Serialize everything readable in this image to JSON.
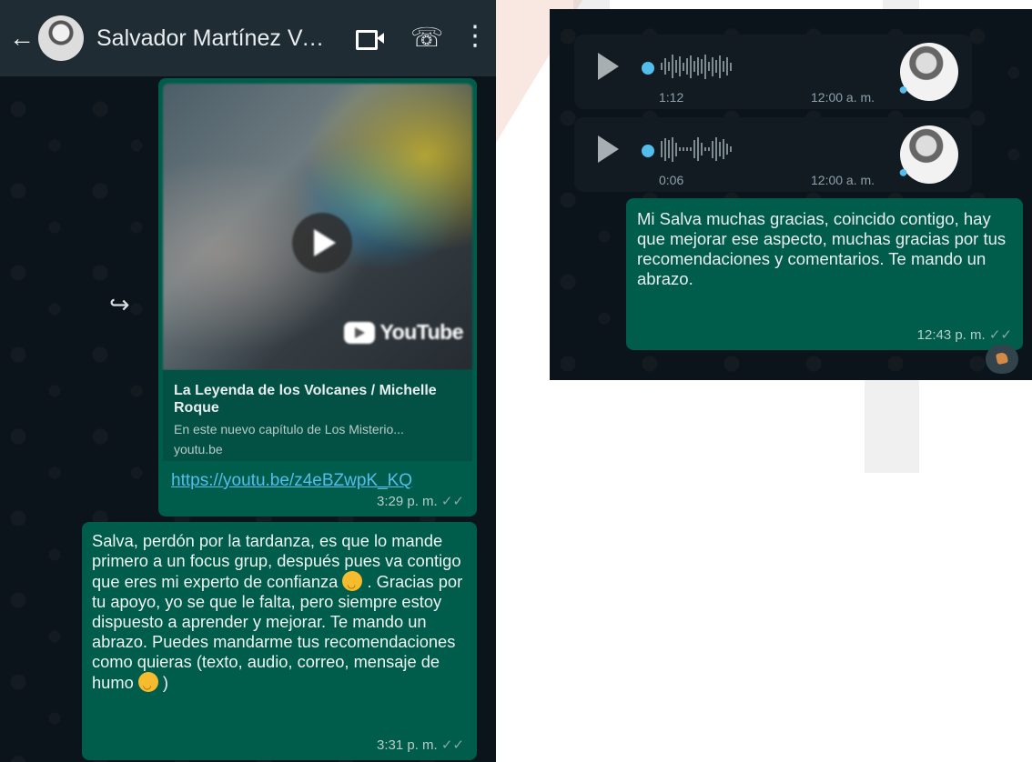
{
  "header": {
    "contact_name": "Salvador Martínez Ve...",
    "back_icon": "arrow-left",
    "video_call_icon": "video-camera",
    "voice_call_icon": "phone",
    "menu_icon": "vertical-ellipsis"
  },
  "conversation_left": {
    "forward_icon": "forward-arrow",
    "video_message": {
      "youtube_label": "YouTube",
      "title": "La Leyenda de los Volcanes / Michelle Roque",
      "description": "En este nuevo capítulo de Los Misterio...",
      "domain": "youtu.be",
      "url": "https://youtu.be/z4eBZwpK_KQ",
      "time": "3:29 p. m.",
      "ticks": "✓✓"
    },
    "text_message": {
      "part1": "Salva, perdón por la tardanza, es que lo mande primero a un focus grup, después pues va contigo que eres mi experto de confianza",
      "part2": ". Gracias por tu apoyo, yo se que le falta, pero siempre estoy dispuesto a aprender y mejorar. Te mando un abrazo. Puedes mandarme tus recomendaciones como quieras (texto, audio, correo, mensaje de humo",
      "part3": ")",
      "time": "3:31 p. m.",
      "ticks": "✓✓"
    }
  },
  "conversation_right": {
    "voice_notes": [
      {
        "duration": "1:12",
        "time": "12:00 a. m."
      },
      {
        "duration": "0:06",
        "time": "12:00 a. m."
      }
    ],
    "reply": {
      "text": "Mi Salva muchas gracias, coincido contigo, hay que mejorar ese aspecto, muchas gracias por tus recomendaciones y comentarios. Te mando un abrazo.",
      "time": "12:43 p. m.",
      "ticks": "✓✓"
    },
    "reaction_icon": "thumbs-up"
  },
  "colors": {
    "chat_background": "#0b141a",
    "header_background": "#1f2c34",
    "outgoing_bubble": "#005c4b",
    "link_blue": "#53bdeb",
    "tick_color": "#8aa8a0"
  }
}
